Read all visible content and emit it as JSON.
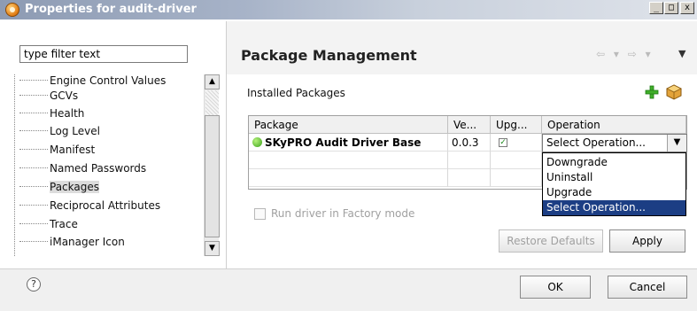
{
  "window": {
    "title": "Properties for audit-driver",
    "controls": [
      "_",
      "□",
      "x"
    ]
  },
  "filter": {
    "value": "type filter text"
  },
  "tree": {
    "items": [
      {
        "label": "Engine Control Values"
      },
      {
        "label": "GCVs"
      },
      {
        "label": "Health"
      },
      {
        "label": "Log Level"
      },
      {
        "label": "Manifest"
      },
      {
        "label": "Named Passwords"
      },
      {
        "label": "Packages",
        "selected": true
      },
      {
        "label": "Reciprocal Attributes"
      },
      {
        "label": "Trace"
      },
      {
        "label": "iManager Icon"
      }
    ]
  },
  "page": {
    "title": "Package Management",
    "section_label": "Installed Packages"
  },
  "table": {
    "columns": [
      "Package",
      "Ve...",
      "Upg...",
      "Operation"
    ],
    "rows": [
      {
        "package": "SKyPRO Audit Driver Base",
        "version": "0.0.3",
        "upgrade_checked": true,
        "operation": "Select Operation..."
      }
    ]
  },
  "dropdown": {
    "options": [
      "Downgrade",
      "Uninstall",
      "Upgrade",
      "Select Operation..."
    ],
    "selected_index": 3
  },
  "factory_mode": {
    "label": "Run driver in Factory mode",
    "checked": false
  },
  "buttons": {
    "restore_defaults": "Restore Defaults",
    "apply": "Apply",
    "ok": "OK",
    "cancel": "Cancel"
  },
  "icons": {
    "help": "?",
    "check": "✓",
    "dropdown_arrow": "▼"
  }
}
